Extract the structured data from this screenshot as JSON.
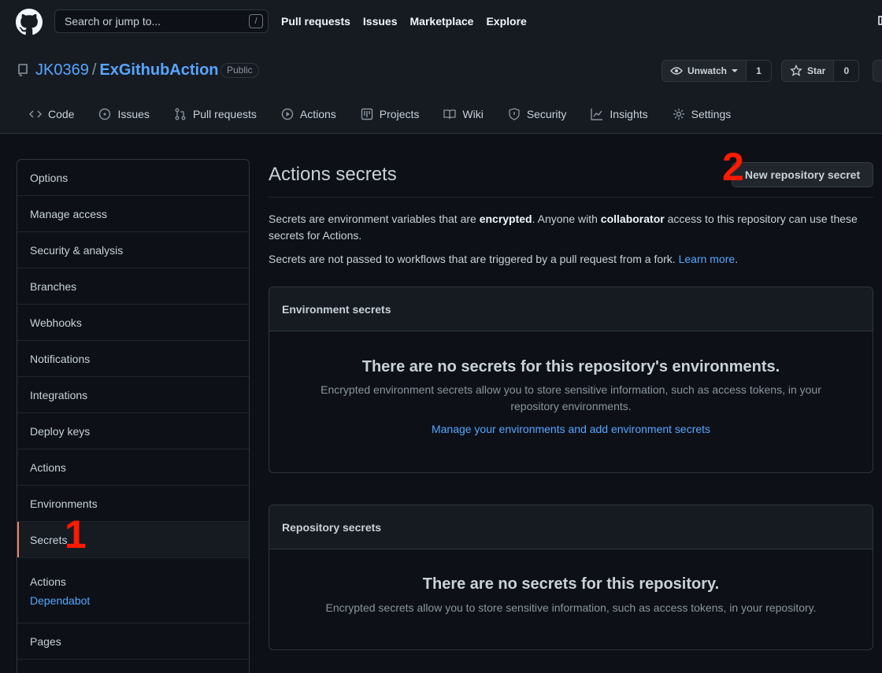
{
  "header": {
    "search_placeholder": "Search or jump to...",
    "search_shortcut": "/",
    "nav": [
      "Pull requests",
      "Issues",
      "Marketplace",
      "Explore"
    ]
  },
  "repo": {
    "owner": "JK0369",
    "separator": "/",
    "name": "ExGithubAction",
    "visibility": "Public",
    "watch_label": "Unwatch",
    "watch_count": "1",
    "star_label": "Star",
    "star_count": "0"
  },
  "tabs": [
    {
      "label": "Code",
      "icon": "code-icon"
    },
    {
      "label": "Issues",
      "icon": "issue-icon"
    },
    {
      "label": "Pull requests",
      "icon": "pull-request-icon"
    },
    {
      "label": "Actions",
      "icon": "play-icon"
    },
    {
      "label": "Projects",
      "icon": "project-icon"
    },
    {
      "label": "Wiki",
      "icon": "book-icon"
    },
    {
      "label": "Security",
      "icon": "shield-icon"
    },
    {
      "label": "Insights",
      "icon": "graph-icon"
    },
    {
      "label": "Settings",
      "icon": "gear-icon"
    }
  ],
  "sidebar": {
    "items": [
      "Options",
      "Manage access",
      "Security & analysis",
      "Branches",
      "Webhooks",
      "Notifications",
      "Integrations",
      "Deploy keys",
      "Actions",
      "Environments",
      "Secrets"
    ],
    "active": "Secrets",
    "group": {
      "heading": "Actions",
      "link": "Dependabot"
    },
    "after": [
      "Pages"
    ]
  },
  "annotations": {
    "one": "1",
    "two": "2"
  },
  "colors": {
    "bg": "#0d1117",
    "link": "#58a6ff",
    "active_marker": "#f78166",
    "annotation": "#ff1a00"
  },
  "main": {
    "title": "Actions secrets",
    "new_button": "New repository secret",
    "desc1_a": "Secrets are environment variables that are ",
    "desc1_b": "encrypted",
    "desc1_c": ". Anyone with ",
    "desc1_d": "collaborator",
    "desc1_e": " access to this repository can use these secrets for Actions.",
    "desc2": "Secrets are not passed to workflows that are triggered by a pull request from a fork. ",
    "learn_more": "Learn more",
    "desc2_end": ".",
    "env": {
      "heading": "Environment secrets",
      "empty_title": "There are no secrets for this repository's environments.",
      "empty_desc": "Encrypted environment secrets allow you to store sensitive information, such as access tokens, in your repository environments.",
      "link": "Manage your environments and add environment secrets"
    },
    "repo_box": {
      "heading": "Repository secrets",
      "empty_title": "There are no secrets for this repository.",
      "empty_desc": "Encrypted secrets allow you to store sensitive information, such as access tokens, in your repository."
    }
  }
}
